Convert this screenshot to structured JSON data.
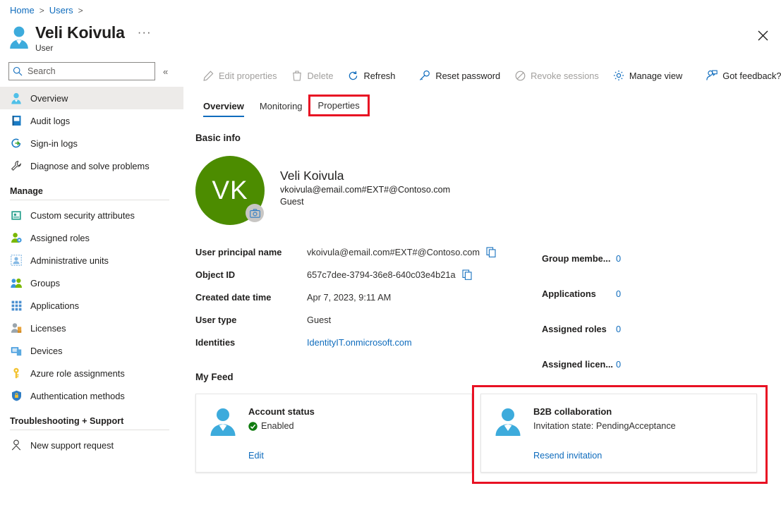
{
  "breadcrumb": {
    "items": [
      "Home",
      "Users"
    ],
    "separator": ">"
  },
  "header": {
    "title": "Veli Koivula",
    "subtitle": "User",
    "more_menu": "···",
    "close_label": "Close"
  },
  "sidebar": {
    "search": {
      "placeholder": "Search",
      "value": ""
    },
    "collapse_label": "«",
    "items": [
      {
        "label": "Overview",
        "icon": "user-icon",
        "selected": true
      },
      {
        "label": "Audit logs",
        "icon": "audit-log-icon",
        "selected": false
      },
      {
        "label": "Sign-in logs",
        "icon": "sign-in-icon",
        "selected": false
      },
      {
        "label": "Diagnose and solve problems",
        "icon": "wrench-icon",
        "selected": false
      }
    ],
    "group_manage": "Manage",
    "manage_items": [
      {
        "label": "Custom security attributes",
        "icon": "security-attributes-icon"
      },
      {
        "label": "Assigned roles",
        "icon": "assigned-roles-icon"
      },
      {
        "label": "Administrative units",
        "icon": "administrative-units-icon"
      },
      {
        "label": "Groups",
        "icon": "groups-icon"
      },
      {
        "label": "Applications",
        "icon": "applications-grid-icon"
      },
      {
        "label": "Licenses",
        "icon": "licenses-icon"
      },
      {
        "label": "Devices",
        "icon": "devices-icon"
      },
      {
        "label": "Azure role assignments",
        "icon": "key-icon"
      },
      {
        "label": "Authentication methods",
        "icon": "shield-lock-icon"
      }
    ],
    "group_troubleshooting": "Troubleshooting + Support",
    "troubleshooting_items": [
      {
        "label": "New support request",
        "icon": "support-person-icon"
      }
    ]
  },
  "toolbar": {
    "commands": [
      {
        "label": "Edit properties",
        "icon": "pencil-icon",
        "disabled": true
      },
      {
        "label": "Delete",
        "icon": "trash-icon",
        "disabled": true
      },
      {
        "label": "Refresh",
        "icon": "refresh-icon",
        "disabled": false
      },
      {
        "label": "Reset password",
        "icon": "key-reset-icon",
        "disabled": false
      },
      {
        "label": "Revoke sessions",
        "icon": "block-icon",
        "disabled": true
      },
      {
        "label": "Manage view",
        "icon": "gear-icon",
        "disabled": false
      },
      {
        "label": "Got feedback?",
        "icon": "feedback-person-icon",
        "disabled": false
      }
    ]
  },
  "tabs": [
    {
      "label": "Overview",
      "active": true,
      "annotated": false
    },
    {
      "label": "Monitoring",
      "active": false,
      "annotated": false
    },
    {
      "label": "Properties",
      "active": false,
      "annotated": true
    }
  ],
  "basic_info": {
    "section_title": "Basic info",
    "avatar": {
      "initials": "VK",
      "color": "#4c8c00",
      "camera_badge": "camera-icon"
    },
    "name": "Veli Koivula",
    "upn": "vkoivula@email.com#EXT#@Contoso.com",
    "user_type": "Guest",
    "properties": [
      {
        "label": "User principal name",
        "value": "vkoivula@email.com#EXT#@Contoso.com",
        "copy": true,
        "link": false
      },
      {
        "label": "Object ID",
        "value": "657c7dee-3794-36e8-640c03e4b21a",
        "copy": true,
        "link": false
      },
      {
        "label": "Created date time",
        "value": "Apr 7, 2023, 9:11 AM",
        "copy": false,
        "link": false
      },
      {
        "label": "User type",
        "value": "Guest",
        "copy": false,
        "link": false
      },
      {
        "label": "Identities",
        "value": "IdentityIT.onmicrosoft.com",
        "copy": false,
        "link": true
      }
    ],
    "stats": [
      {
        "label": "Group membe...",
        "value": "0"
      },
      {
        "label": "Applications",
        "value": "0"
      },
      {
        "label": "Assigned roles",
        "value": "0"
      },
      {
        "label": "Assigned licen...",
        "value": "0"
      }
    ]
  },
  "my_feed": {
    "section_title": "My Feed",
    "cards": [
      {
        "title": "Account status",
        "status": "Enabled",
        "status_icon": "check-circle-icon",
        "link": "Edit",
        "icon": "person-icon",
        "annotated": false
      },
      {
        "title": "B2B collaboration",
        "status": "Invitation state: PendingAcceptance",
        "status_icon": "",
        "link": "Resend invitation",
        "icon": "person-icon",
        "annotated": true
      }
    ]
  },
  "colors": {
    "accent_blue": "#0f6cbd",
    "annotation_red": "#e81123",
    "avatar_green": "#4c8c00",
    "status_green": "#107c10"
  }
}
